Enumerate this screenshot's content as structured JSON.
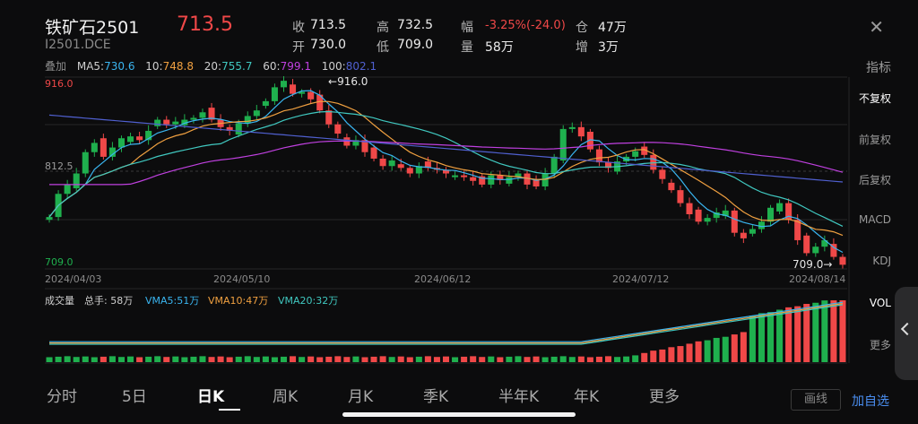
{
  "header": {
    "title": "铁矿石2501",
    "price": "713.5",
    "code": "I2501.DCE",
    "quotes": [
      {
        "label": "收",
        "value": "713.5"
      },
      {
        "label": "高",
        "value": "732.5"
      },
      {
        "label": "幅",
        "value": "-3.25%(-24.0)"
      },
      {
        "label": "仓",
        "value": "47万"
      },
      {
        "label": "开",
        "value": "730.0"
      },
      {
        "label": "低",
        "value": "709.0"
      },
      {
        "label": "量",
        "value": "58万"
      },
      {
        "label": "增",
        "value": "3万"
      }
    ]
  },
  "ma": {
    "prefix": "叠加",
    "items": [
      {
        "label": "MA5:",
        "value": "730.6",
        "color": "#3ab5f0"
      },
      {
        "label": "10:",
        "value": "748.8",
        "color": "#f0a040"
      },
      {
        "label": "20:",
        "value": "755.7",
        "color": "#40c8c0"
      },
      {
        "label": "60:",
        "value": "799.1",
        "color": "#c040e0"
      },
      {
        "label": "100:",
        "value": "802.1",
        "color": "#5060d0"
      }
    ]
  },
  "side_menu": {
    "title": "指标",
    "items": [
      "不复权",
      "前复权",
      "后复权",
      "MACD",
      "KDJ",
      "VOL",
      "更多"
    ]
  },
  "chart_labels": {
    "top": "916.0",
    "mid": "812.5",
    "bottom": "709.0",
    "high_marker": "916.0",
    "low_marker": "709.0",
    "dates": [
      "2024/04/03",
      "2024/05/10",
      "2024/06/12",
      "2024/07/12",
      "2024/08/14"
    ]
  },
  "volume": {
    "title": "成交量",
    "total": "总手: 58万",
    "vma5": "VMA5:51万",
    "vma10": "VMA10:47万",
    "vma20": "VMA20:32万"
  },
  "tabs": [
    "分时",
    "5日",
    "日K",
    "周K",
    "月K",
    "季K",
    "半年K",
    "年K",
    "更多"
  ],
  "buttons": {
    "draw": "画线",
    "add_fav": "加自选"
  },
  "colors": {
    "up": "#f04848",
    "down": "#1fb04e",
    "accent": "#4a8ef0"
  },
  "chart_data": {
    "type": "candlestick",
    "ylim": [
      709.0,
      916.0
    ],
    "x_ticks": [
      "2024/04/03",
      "2024/05/10",
      "2024/06/12",
      "2024/07/12",
      "2024/08/14"
    ],
    "closes_approx": [
      765,
      790,
      800,
      812,
      835,
      845,
      830,
      840,
      850,
      852,
      848,
      858,
      870,
      865,
      868,
      870,
      872,
      878,
      870,
      862,
      858,
      866,
      874,
      880,
      890,
      905,
      912,
      898,
      900,
      892,
      880,
      865,
      855,
      842,
      848,
      835,
      828,
      820,
      826,
      818,
      812,
      820,
      818,
      816,
      812,
      810,
      808,
      804,
      800,
      810,
      805,
      808,
      812,
      800,
      798,
      812,
      830,
      860,
      862,
      852,
      838,
      824,
      818,
      825,
      830,
      836,
      832,
      816,
      806,
      794,
      780,
      768,
      760,
      764,
      770,
      772,
      748,
      742,
      752,
      760,
      775,
      780,
      762,
      740,
      726,
      733,
      740,
      722,
      713.5
    ],
    "series": [
      {
        "name": "MA5",
        "last": 730.6
      },
      {
        "name": "MA10",
        "last": 748.8
      },
      {
        "name": "MA20",
        "last": 755.7
      },
      {
        "name": "MA60",
        "last": 799.1
      },
      {
        "name": "MA100",
        "last": 802.1
      }
    ]
  }
}
